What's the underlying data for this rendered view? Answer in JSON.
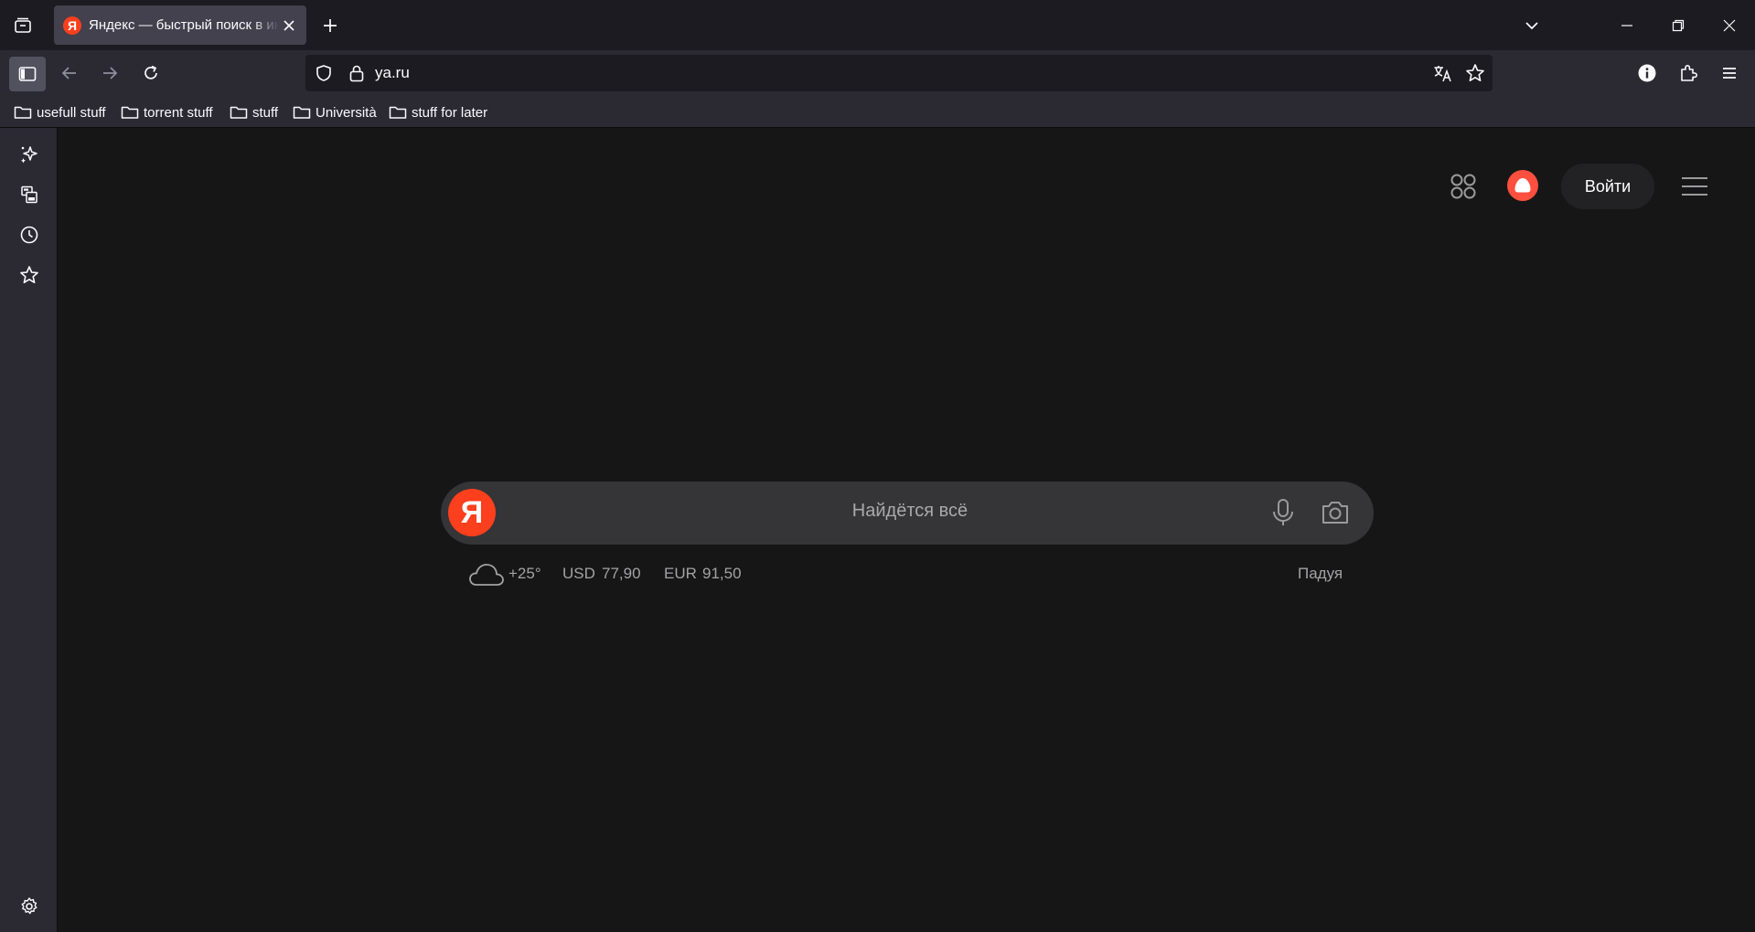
{
  "colors": {
    "accent": "#fc3f1d",
    "alice": "#ff4f3e",
    "background": "#161617",
    "chrome": "#2b2a33",
    "tab_active": "#42414d"
  },
  "tab": {
    "title": "Яндекс — быстрый поиск в интернете",
    "favicon_letter": "Я"
  },
  "toolbar": {
    "url": "ya.ru"
  },
  "bookmarks": [
    {
      "label": "usefull stuff"
    },
    {
      "label": "torrent stuff"
    },
    {
      "label": "stuff"
    },
    {
      "label": "Università"
    },
    {
      "label": "stuff for later"
    }
  ],
  "sidebar": {
    "items": [
      {
        "icon": "ai-chatbot-icon"
      },
      {
        "icon": "synced-tabs-icon"
      },
      {
        "icon": "history-icon"
      },
      {
        "icon": "bookmarks-icon"
      }
    ],
    "settings_icon": "gear-icon"
  },
  "header": {
    "login_label": "Войти"
  },
  "search": {
    "logo_letter": "Я",
    "placeholder": "Найдётся всё"
  },
  "info": {
    "weather": "+25°",
    "usd_label": "USD",
    "usd_value": "77,90",
    "eur_label": "EUR",
    "eur_value": "91,50",
    "city": "Падуя"
  }
}
